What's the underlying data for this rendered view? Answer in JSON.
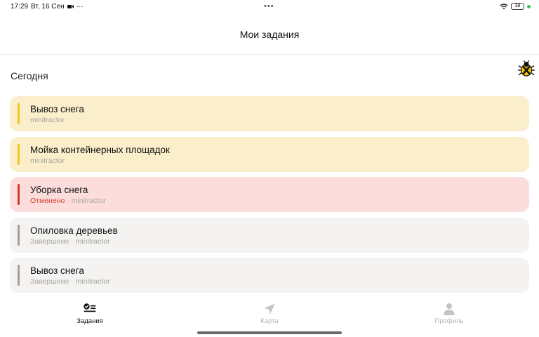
{
  "status_bar": {
    "time": "17:29",
    "date": "Вт, 16 Сен",
    "more": "···",
    "center_dots": "•••",
    "battery": "38"
  },
  "header": {
    "title": "Мои задания"
  },
  "section": {
    "title": "Сегодня"
  },
  "tasks": [
    {
      "title": "Вывоз снега",
      "status": "",
      "vehicle": "minitractor",
      "state": "open",
      "accent": "#f2c51e"
    },
    {
      "title": "Мойка контейнерных площадок",
      "status": "",
      "vehicle": "minitractor",
      "state": "open",
      "accent": "#f2c51e"
    },
    {
      "title": "Уборка снега",
      "status": "Отменено",
      "separator": " · ",
      "vehicle": "minitractor",
      "state": "cancelled",
      "accent": "#d33a2c"
    },
    {
      "title": "Опиловка деревьев",
      "status": "Завершено",
      "separator": " · ",
      "vehicle": "minitractor",
      "state": "done",
      "accent": "#a19d98"
    },
    {
      "title": "Вывоз снега",
      "status": "Завершено",
      "separator": " · ",
      "vehicle": "minitractor",
      "state": "done",
      "accent": "#a19d98"
    }
  ],
  "tabs": [
    {
      "label": "Задания",
      "icon": "tasks-list-icon",
      "active": true
    },
    {
      "label": "Карта",
      "icon": "navigation-arrow-icon",
      "active": false
    },
    {
      "label": "Профиль",
      "icon": "user-profile-icon",
      "active": false
    }
  ],
  "colors": {
    "open_bg": "#fbeeca",
    "cancelled_bg": "#fcdddc",
    "done_bg": "#f4f3f1",
    "cancelled_text": "#d33a2c"
  }
}
